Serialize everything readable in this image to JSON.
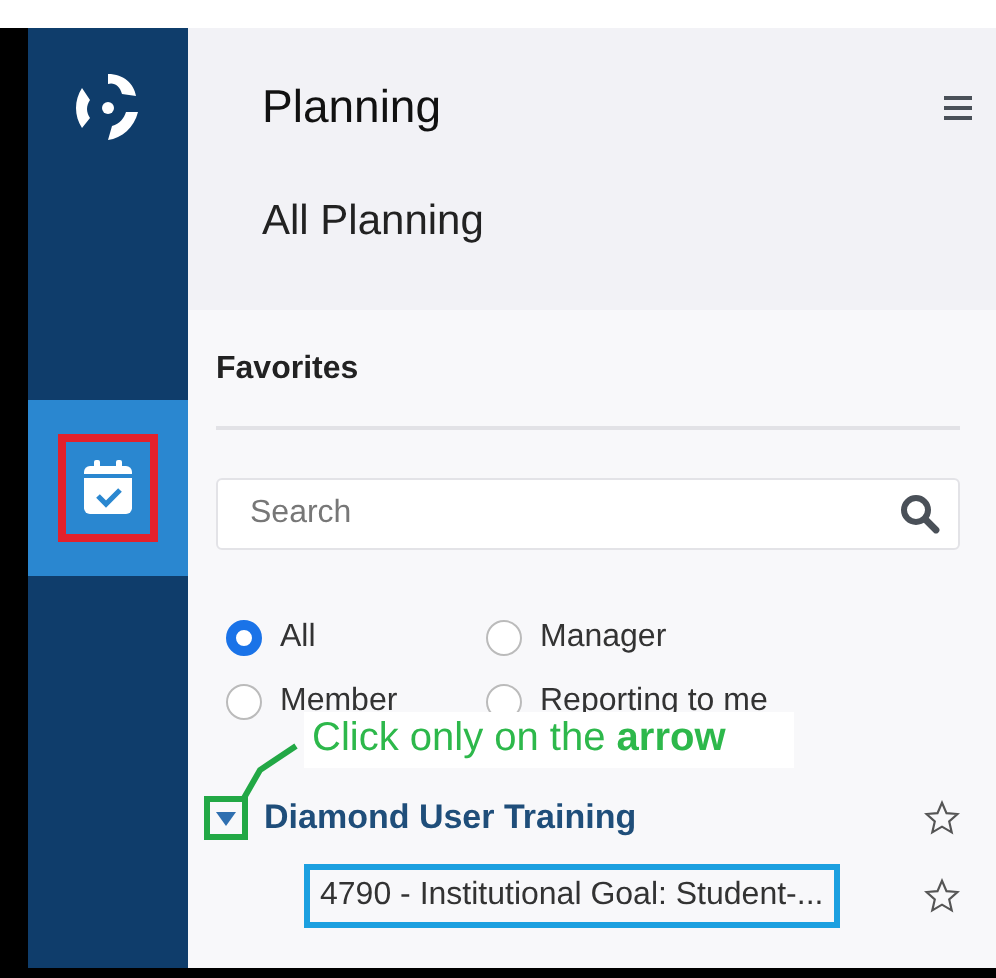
{
  "sidebar": {
    "items": [
      {
        "kind": "calendar",
        "selected": true
      }
    ]
  },
  "header": {
    "title": "Planning",
    "subtitle": "All Planning"
  },
  "favorites": {
    "title": "Favorites",
    "search": {
      "placeholder": "Search"
    },
    "filters": [
      {
        "label": "All",
        "selected": true
      },
      {
        "label": "Manager",
        "selected": false
      },
      {
        "label": "Member",
        "selected": false
      },
      {
        "label": "Reporting to me",
        "selected": false
      }
    ],
    "tree": [
      {
        "label": "Diamond User Training",
        "expanded": true,
        "children": [
          {
            "label": "4790 - Institutional Goal: Student-..."
          }
        ]
      }
    ]
  },
  "annotation": {
    "text": "Click only on the **arrow**"
  }
}
